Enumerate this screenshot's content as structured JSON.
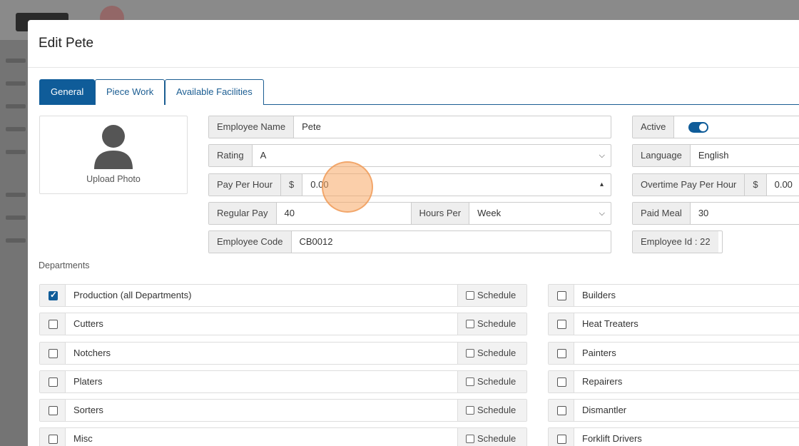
{
  "modal": {
    "title": "Edit Pete"
  },
  "tabs": [
    {
      "label": "General",
      "active": true
    },
    {
      "label": "Piece Work",
      "active": false
    },
    {
      "label": "Available Facilities",
      "active": false
    }
  ],
  "photo": {
    "label": "Upload Photo",
    "icon": "user-silhouette-icon"
  },
  "form": {
    "employee_name": {
      "label": "Employee Name",
      "value": "Pete"
    },
    "rating": {
      "label": "Rating",
      "value": "A"
    },
    "pay_per_hour": {
      "label": "Pay Per Hour",
      "currency": "$",
      "value": "0.00"
    },
    "regular_pay": {
      "label": "Regular Pay",
      "value": "40"
    },
    "hours_per": {
      "label": "Hours Per",
      "value": "Week"
    },
    "employee_code": {
      "label": "Employee Code",
      "value": "CB0012"
    },
    "active": {
      "label": "Active",
      "on": true
    },
    "language": {
      "label": "Language",
      "value": "English"
    },
    "overtime_pay": {
      "label": "Overtime Pay Per Hour",
      "currency": "$",
      "value": "0.00"
    },
    "paid_meal": {
      "label": "Paid Meal",
      "value": "30"
    },
    "employee_id": {
      "label": "Employee Id : 22"
    }
  },
  "departments": {
    "heading": "Departments",
    "schedule_label": "Schedule",
    "left": [
      {
        "name": "Production (all Departments)",
        "checked": true
      },
      {
        "name": "Cutters",
        "checked": false
      },
      {
        "name": "Notchers",
        "checked": false
      },
      {
        "name": "Platers",
        "checked": false
      },
      {
        "name": "Sorters",
        "checked": false
      },
      {
        "name": "Misc",
        "checked": false
      }
    ],
    "right": [
      {
        "name": "Builders",
        "checked": false
      },
      {
        "name": "Heat Treaters",
        "checked": false
      },
      {
        "name": "Painters",
        "checked": false
      },
      {
        "name": "Repairers",
        "checked": false
      },
      {
        "name": "Dismantler",
        "checked": false
      },
      {
        "name": "Forklift Drivers",
        "checked": false
      }
    ]
  },
  "colors": {
    "primary": "#0f5c99",
    "click_highlight": "#f7a864"
  }
}
